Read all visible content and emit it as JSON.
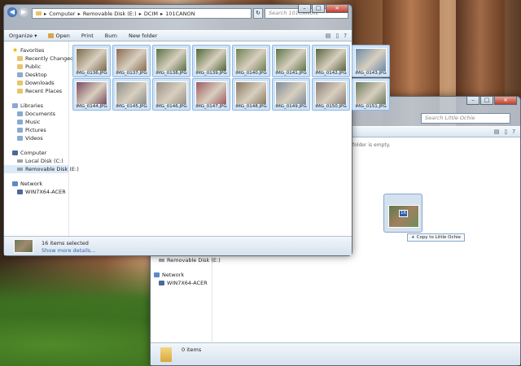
{
  "front_window": {
    "breadcrumb": [
      "Computer",
      "Removable Disk (E:)",
      "DCIM",
      "101CANON"
    ],
    "search_placeholder": "Search 101CANON",
    "toolbar": {
      "organize": "Organize ▾",
      "open": "Open",
      "print": "Print",
      "burn": "Burn",
      "new_folder": "New folder"
    },
    "nav": {
      "favorites": "Favorites",
      "recently_changed": "Recently Changed",
      "public": "Public",
      "desktop": "Desktop",
      "downloads": "Downloads",
      "recent_places": "Recent Places",
      "libraries": "Libraries",
      "documents": "Documents",
      "music": "Music",
      "pictures": "Pictures",
      "videos": "Videos",
      "computer": "Computer",
      "local_disk": "Local Disk (C:)",
      "removable_disk": "Removable Disk (E:)",
      "network": "Network",
      "win7x64": "WIN7X64-ACER"
    },
    "files": [
      {
        "name": "IMG_0136.JPG",
        "color": "#7a6a4a"
      },
      {
        "name": "IMG_0137.JPG",
        "color": "#8a6a50"
      },
      {
        "name": "IMG_0138.JPG",
        "color": "#5a7044"
      },
      {
        "name": "IMG_0139.JPG",
        "color": "#4e6838"
      },
      {
        "name": "IMG_0140.JPG",
        "color": "#6e8050"
      },
      {
        "name": "IMG_0141.JPG",
        "color": "#5c7448"
      },
      {
        "name": "IMG_0142.JPG",
        "color": "#586440"
      },
      {
        "name": "IMG_0143.JPG",
        "color": "#6a8aa8"
      },
      {
        "name": "IMG_0144.JPG",
        "color": "#7a4a5e"
      },
      {
        "name": "IMG_0145.JPG",
        "color": "#8a8e88"
      },
      {
        "name": "IMG_0146.JPG",
        "color": "#9a9288"
      },
      {
        "name": "IMG_0147.JPG",
        "color": "#9e5a60"
      },
      {
        "name": "IMG_0148.JPG",
        "color": "#8a7a62"
      },
      {
        "name": "IMG_0149.JPG",
        "color": "#7f8c98"
      },
      {
        "name": "IMG_0150.JPG",
        "color": "#8a7e78"
      },
      {
        "name": "IMG_0151.JPG",
        "color": "#6a7a5a"
      }
    ],
    "status": {
      "selected": "16 items selected",
      "show_more": "Show more details..."
    }
  },
  "back_window": {
    "search_placeholder": "Search Little Ochie",
    "empty_message": "folder is empty.",
    "nav": {
      "removable_disk": "Removable Disk (E:)",
      "network": "Network",
      "win7x64": "WIN7X64-ACER"
    },
    "status": {
      "items": "0 items"
    }
  },
  "drag": {
    "count": "16",
    "tooltip": "Copy to Little Ochie"
  }
}
